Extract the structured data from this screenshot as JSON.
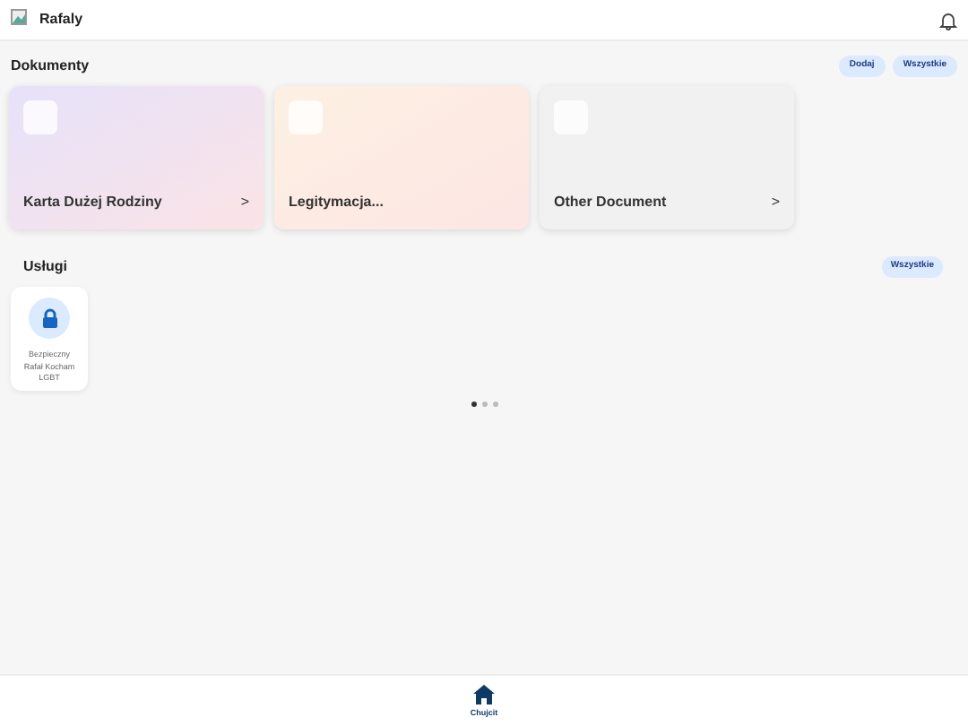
{
  "header": {
    "title": "Rafaly"
  },
  "documents": {
    "title": "Dokumenty",
    "buttons": [
      "Dodaj",
      "Wszystkie"
    ],
    "cards": [
      {
        "label": "Karta Dużej Rodziny",
        "arrow": ">",
        "kind": "purple"
      },
      {
        "label": "Legitymacja...",
        "kind": "orange"
      },
      {
        "label": "Other Document",
        "arrow": ">",
        "kind": "grey"
      }
    ]
  },
  "services": {
    "title": "Usługi",
    "button": "Wszystkie",
    "items": [
      {
        "label": "Bezpieczny Rafał Kocham LGBT"
      }
    ]
  },
  "pager": [
    {
      "selected": true
    },
    {
      "selected": false
    },
    {
      "selected": false
    }
  ],
  "bottom_nav": [
    {
      "label": "Chujcit",
      "selected": true
    }
  ]
}
